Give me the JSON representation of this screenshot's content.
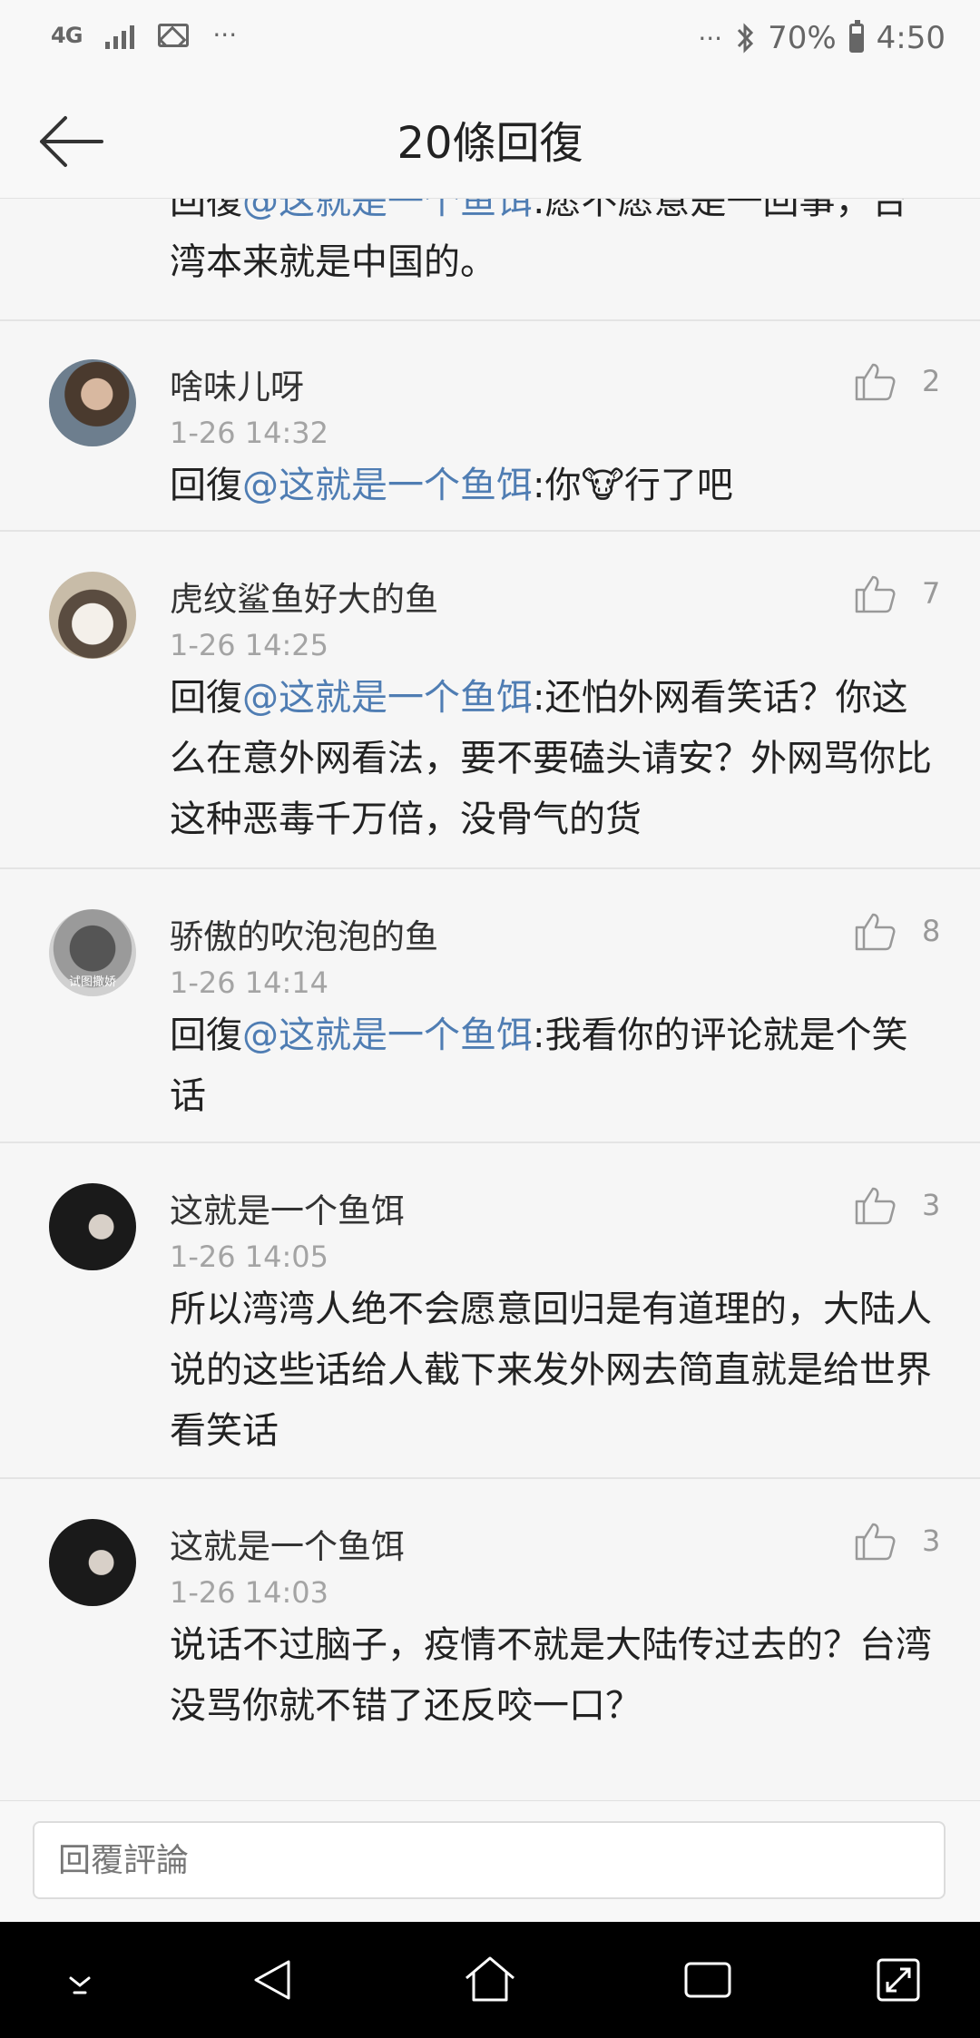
{
  "status_bar": {
    "network": "4G",
    "battery_pct": "70%",
    "time": "4:50",
    "more_left": "···",
    "more_right": "···"
  },
  "header": {
    "title": "20條回復"
  },
  "first_comment_tail": {
    "prefix": "回復",
    "mention": "@这就是一个鱼饵",
    "text": ":愿不愿意是一回事，台湾本来就是中国的。"
  },
  "comments": [
    {
      "user": "啥味儿呀",
      "time": "1-26 14:32",
      "likes": "2",
      "prefix": "回復",
      "mention": "@这就是一个鱼饵",
      "text": ":你🐮行了吧"
    },
    {
      "user": "虎纹鲨鱼好大的鱼",
      "time": "1-26 14:25",
      "likes": "7",
      "prefix": "回復",
      "mention": "@这就是一个鱼饵",
      "text": ":还怕外网看笑话？你这么在意外网看法，要不要磕头请安？外网骂你比这种恶毒千万倍，没骨气的货"
    },
    {
      "user": "骄傲的吹泡泡的鱼",
      "time": "1-26 14:14",
      "likes": "8",
      "prefix": "回復",
      "mention": "@这就是一个鱼饵",
      "text": ":我看你的评论就是个笑话",
      "avatar_caption": "试图撒娇"
    },
    {
      "user": "这就是一个鱼饵",
      "time": "1-26 14:05",
      "likes": "3",
      "prefix": "",
      "mention": "",
      "text": "所以湾湾人绝不会愿意回归是有道理的，大陆人说的这些话给人截下来发外网去简直就是给世界看笑话"
    },
    {
      "user": "这就是一个鱼饵",
      "time": "1-26 14:03",
      "likes": "3",
      "prefix": "",
      "mention": "",
      "text": "说话不过脑子，疫情不就是大陆传过去的？台湾没骂你就不错了还反咬一口？"
    }
  ],
  "input": {
    "placeholder": "回覆評論"
  },
  "icons": {
    "back": "arrow-left-icon",
    "like": "thumbs-up-icon",
    "nav": [
      "chevron-down-icon",
      "back-triangle-icon",
      "home-icon",
      "recents-icon",
      "expand-icon"
    ]
  },
  "colors": {
    "mention": "#4f7db3",
    "background": "#f6f6f6",
    "navbar": "#000000"
  }
}
